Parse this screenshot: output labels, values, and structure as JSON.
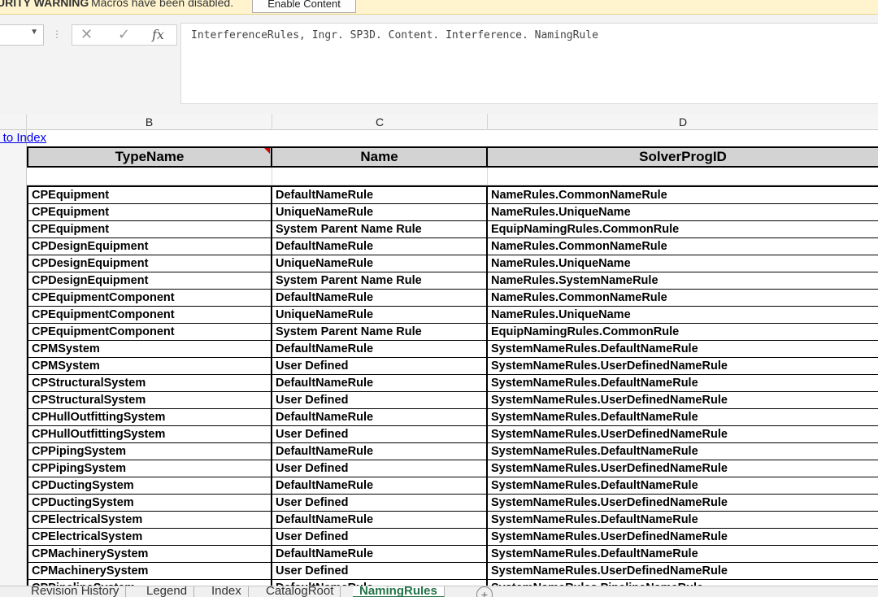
{
  "security_bar": {
    "title": "URITY WARNING",
    "message": "Macros have been disabled.",
    "enable_button": "Enable Content"
  },
  "formula_bar": {
    "cancel_icon": "close-icon",
    "enter_icon": "check-icon",
    "fx_label": "fx",
    "content": "InterferenceRules, Ingr. SP3D. Content. Interference. NamingRule"
  },
  "columns": [
    "B",
    "C",
    "D"
  ],
  "link_text": "k to Index",
  "table": {
    "headers": [
      "TypeName",
      "Name",
      "SolverProgID"
    ],
    "rows": [
      [
        "CPEquipment",
        "DefaultNameRule",
        "NameRules.CommonNameRule"
      ],
      [
        "CPEquipment",
        "UniqueNameRule",
        "NameRules.UniqueName"
      ],
      [
        "CPEquipment",
        "System Parent Name Rule",
        "EquipNamingRules.CommonRule"
      ],
      [
        "CPDesignEquipment",
        "DefaultNameRule",
        "NameRules.CommonNameRule"
      ],
      [
        "CPDesignEquipment",
        "UniqueNameRule",
        "NameRules.UniqueName"
      ],
      [
        "CPDesignEquipment",
        "System Parent Name Rule",
        "NameRules.SystemNameRule"
      ],
      [
        "CPEquipmentComponent",
        "DefaultNameRule",
        "NameRules.CommonNameRule"
      ],
      [
        "CPEquipmentComponent",
        "UniqueNameRule",
        "NameRules.UniqueName"
      ],
      [
        "CPEquipmentComponent",
        "System Parent Name Rule",
        "EquipNamingRules.CommonRule"
      ],
      [
        "CPMSystem",
        "DefaultNameRule",
        "SystemNameRules.DefaultNameRule"
      ],
      [
        "CPMSystem",
        "User Defined",
        "SystemNameRules.UserDefinedNameRule"
      ],
      [
        "CPStructuralSystem",
        "DefaultNameRule",
        "SystemNameRules.DefaultNameRule"
      ],
      [
        "CPStructuralSystem",
        "User Defined",
        "SystemNameRules.UserDefinedNameRule"
      ],
      [
        "CPHullOutfittingSystem",
        "DefaultNameRule",
        "SystemNameRules.DefaultNameRule"
      ],
      [
        "CPHullOutfittingSystem",
        "User Defined",
        "SystemNameRules.UserDefinedNameRule"
      ],
      [
        "CPPipingSystem",
        "DefaultNameRule",
        "SystemNameRules.DefaultNameRule"
      ],
      [
        "CPPipingSystem",
        "User Defined",
        "SystemNameRules.UserDefinedNameRule"
      ],
      [
        "CPDuctingSystem",
        "DefaultNameRule",
        "SystemNameRules.DefaultNameRule"
      ],
      [
        "CPDuctingSystem",
        "User Defined",
        "SystemNameRules.UserDefinedNameRule"
      ],
      [
        "CPElectricalSystem",
        "DefaultNameRule",
        "SystemNameRules.DefaultNameRule"
      ],
      [
        "CPElectricalSystem",
        "User Defined",
        "SystemNameRules.UserDefinedNameRule"
      ],
      [
        "CPMachinerySystem",
        "DefaultNameRule",
        "SystemNameRules.DefaultNameRule"
      ],
      [
        "CPMachinerySystem",
        "User Defined",
        "SystemNameRules.UserDefinedNameRule"
      ],
      [
        "CPPipelineSystem",
        "DefaultNameRule",
        "SystemNameRules.PipelineNameRule"
      ]
    ]
  },
  "sheet_tabs": [
    "Revision History",
    "Legend",
    "Index",
    "CatalogRoot",
    "NamingRules"
  ],
  "active_tab": "NamingRules",
  "add_sheet_icon": "plus-circle-icon",
  "colors": {
    "accent": "#217346",
    "warning_bg": "#fff4ce",
    "header_fill": "#d3d3d3",
    "link": "#0000ee"
  }
}
